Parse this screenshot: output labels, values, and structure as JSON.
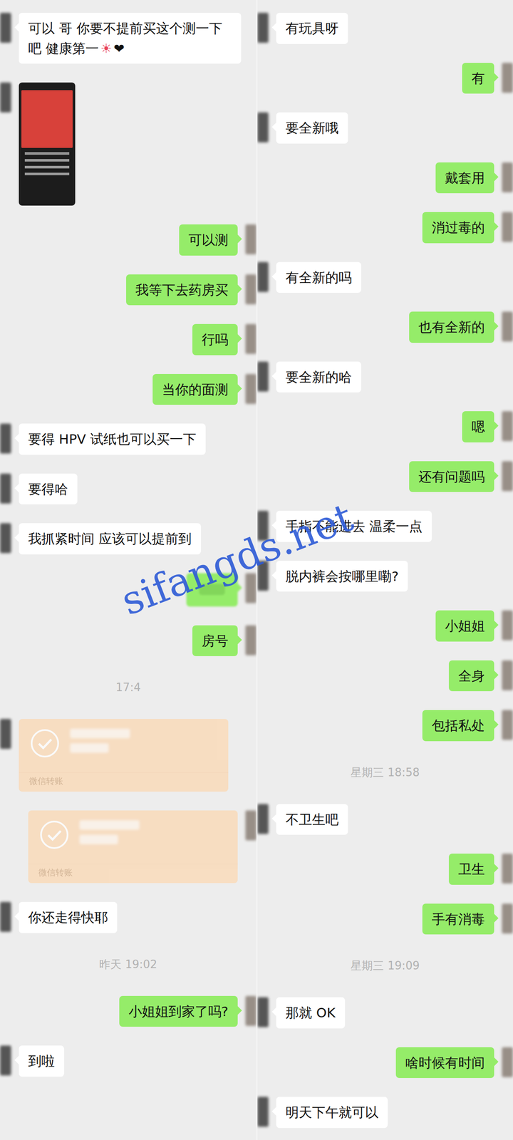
{
  "watermark": "sifangds.net",
  "columns": [
    {
      "messages": [
        {
          "kind": "text",
          "side": "other",
          "text": "可以 哥 你要不提前买这个测一下吧 健康第一",
          "icons": [
            "☀",
            "❤"
          ]
        },
        {
          "kind": "image",
          "side": "other"
        },
        {
          "kind": "text",
          "side": "self",
          "text": "可以测"
        },
        {
          "kind": "text",
          "side": "self",
          "text": "我等下去药房买"
        },
        {
          "kind": "text",
          "side": "self",
          "text": "行吗"
        },
        {
          "kind": "text",
          "side": "self",
          "text": "当你的面测"
        },
        {
          "kind": "text",
          "side": "other",
          "text": "要得 HPV 试纸也可以买一下"
        },
        {
          "kind": "text",
          "side": "other",
          "text": "要得哈"
        },
        {
          "kind": "text",
          "side": "other",
          "text": "我抓紧时间 应该可以提前到"
        },
        {
          "kind": "blurred",
          "side": "self"
        },
        {
          "kind": "text",
          "side": "self",
          "text": "房号"
        },
        {
          "kind": "time",
          "text": "17:4"
        },
        {
          "kind": "transfer",
          "side": "other",
          "text": "微信转账"
        },
        {
          "kind": "transfer",
          "side": "self",
          "text": "微信转账"
        },
        {
          "kind": "text",
          "side": "other",
          "text": "你还走得快耶"
        },
        {
          "kind": "time",
          "text": "昨天 19:02"
        },
        {
          "kind": "text",
          "side": "self",
          "text": "小姐姐到家了吗?"
        },
        {
          "kind": "text",
          "side": "other",
          "text": "到啦"
        }
      ]
    },
    {
      "messages": [
        {
          "kind": "text",
          "side": "other",
          "text": "有玩具呀"
        },
        {
          "kind": "text",
          "side": "self",
          "text": "有"
        },
        {
          "kind": "text",
          "side": "other",
          "text": "要全新哦"
        },
        {
          "kind": "text",
          "side": "self",
          "text": "戴套用"
        },
        {
          "kind": "text",
          "side": "self",
          "text": "消过毒的"
        },
        {
          "kind": "text",
          "side": "other",
          "text": "有全新的吗"
        },
        {
          "kind": "text",
          "side": "self",
          "text": "也有全新的"
        },
        {
          "kind": "text",
          "side": "other",
          "text": "要全新的哈"
        },
        {
          "kind": "text",
          "side": "self",
          "text": "嗯"
        },
        {
          "kind": "text",
          "side": "self",
          "text": "还有问题吗"
        },
        {
          "kind": "text",
          "side": "other",
          "text": "手指不能进去 温柔一点"
        },
        {
          "kind": "text",
          "side": "other",
          "text": "脱内裤会按哪里嘞?"
        },
        {
          "kind": "text",
          "side": "self",
          "text": "小姐姐"
        },
        {
          "kind": "text",
          "side": "self",
          "text": "全身"
        },
        {
          "kind": "text",
          "side": "self",
          "text": "包括私处"
        },
        {
          "kind": "time",
          "text": "星期三 18:58"
        },
        {
          "kind": "text",
          "side": "other",
          "text": "不卫生吧"
        },
        {
          "kind": "text",
          "side": "self",
          "text": "卫生"
        },
        {
          "kind": "text",
          "side": "self",
          "text": "手有消毒"
        },
        {
          "kind": "time",
          "text": "星期三 19:09"
        },
        {
          "kind": "text",
          "side": "other",
          "text": "那就 OK"
        },
        {
          "kind": "text",
          "side": "self",
          "text": "啥时候有时间"
        },
        {
          "kind": "text",
          "side": "other",
          "text": "明天下午就可以"
        }
      ]
    }
  ]
}
